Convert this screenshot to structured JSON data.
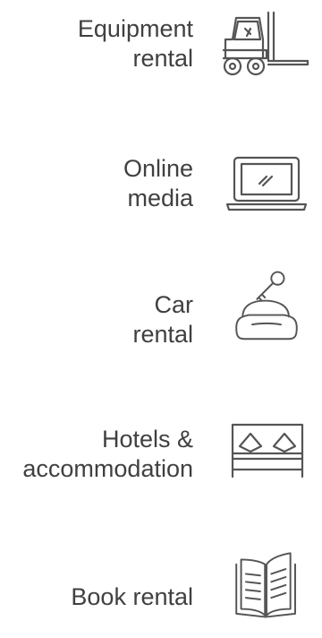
{
  "items": [
    {
      "line1": "Equipment",
      "line2": "rental",
      "icon": "forklift-icon"
    },
    {
      "line1": "Online",
      "line2": "media",
      "icon": "laptop-icon"
    },
    {
      "line1": "Car",
      "line2": "rental",
      "icon": "car-key-icon"
    },
    {
      "line1": "Hotels &",
      "line2": "accommodation",
      "icon": "bed-icon"
    },
    {
      "line1": "Book rental",
      "line2": "",
      "icon": "book-icon"
    }
  ],
  "colors": {
    "text": "#404040",
    "icon_stroke": "#555555",
    "background": "#ffffff"
  }
}
